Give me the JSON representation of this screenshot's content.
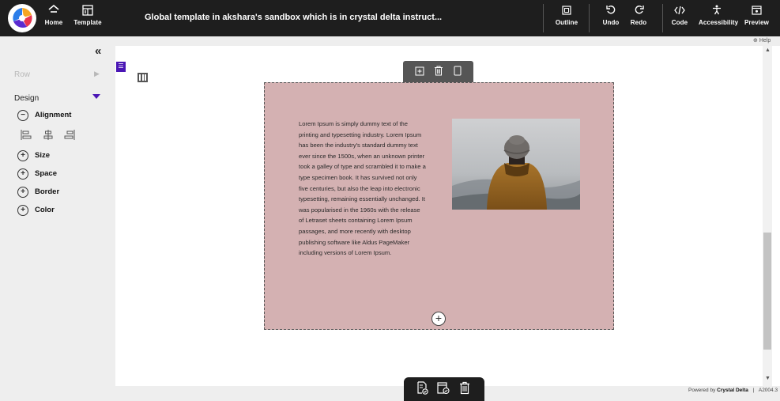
{
  "topbar": {
    "title": "Global template in akshara's sandbox which is in crystal delta instruct...",
    "home_label": "Home",
    "template_label": "Template",
    "outline_label": "Outline",
    "undo_label": "Undo",
    "redo_label": "Redo",
    "code_label": "Code",
    "accessibility_label": "Accessibility",
    "preview_label": "Preview"
  },
  "leftpanel": {
    "collapse_glyph": "«",
    "row_label": "Row",
    "design_label": "Design",
    "sections": [
      {
        "label": "Alignment",
        "state": "−"
      },
      {
        "label": "Size",
        "state": "+"
      },
      {
        "label": "Space",
        "state": "+"
      },
      {
        "label": "Border",
        "state": "+"
      },
      {
        "label": "Color",
        "state": "+"
      }
    ]
  },
  "help_label": "Help",
  "content": {
    "lorem": "Lorem Ipsum is simply dummy text of the printing and typesetting industry. Lorem Ipsum has been the industry's standard dummy text ever since the 1500s, when an unknown printer took a galley of type and scrambled it to make a type specimen book. It has survived not only five centuries, but also the leap into electronic typesetting, remaining essentially unchanged. It was popularised in the 1960s with the release of Letraset sheets containing Lorem Ipsum passages, and more recently with desktop publishing software like Aldus PageMaker including versions of Lorem Ipsum.",
    "add_glyph": "+"
  },
  "footer": {
    "powered_prefix": "Powered by ",
    "powered_brand": "Crystal Delta",
    "separator": "|",
    "version": "A2004.3"
  },
  "colors": {
    "topbar": "#1e1e1e",
    "accent": "#4a16b5",
    "section_bg": "#d4b1b2"
  }
}
